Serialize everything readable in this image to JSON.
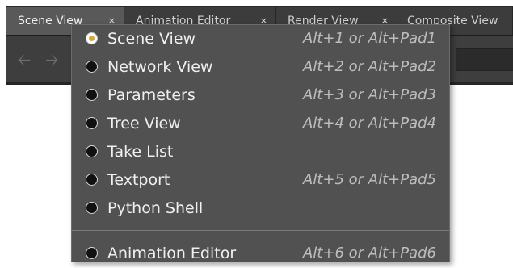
{
  "tabs": [
    {
      "label": "Scene View",
      "active": true
    },
    {
      "label": "Animation Editor",
      "active": false
    },
    {
      "label": "Render View",
      "active": false
    },
    {
      "label": "Composite View",
      "active": false
    }
  ],
  "tab_close_glyph": "×",
  "toolbar": {
    "back_icon": "arrow-left-icon",
    "forward_icon": "arrow-right-icon"
  },
  "menu": {
    "items": [
      {
        "label": "Scene View",
        "shortcut": "Alt+1 or Alt+Pad1",
        "checked": true
      },
      {
        "label": "Network View",
        "shortcut": "Alt+2 or Alt+Pad2",
        "checked": false
      },
      {
        "label": "Parameters",
        "shortcut": "Alt+3 or Alt+Pad3",
        "checked": false
      },
      {
        "label": "Tree View",
        "shortcut": "Alt+4 or Alt+Pad4",
        "checked": false
      },
      {
        "label": "Take List",
        "shortcut": "",
        "checked": false
      },
      {
        "label": "Textport",
        "shortcut": "Alt+5 or Alt+Pad5",
        "checked": false
      },
      {
        "label": "Python Shell",
        "shortcut": "",
        "checked": false
      },
      {
        "label": "Animation Editor",
        "shortcut": "Alt+6 or Alt+Pad6",
        "checked": false
      }
    ]
  },
  "colors": {
    "accent_radio": "#d9a933",
    "menu_bg": "#515151",
    "tab_active_bg": "#595959"
  }
}
